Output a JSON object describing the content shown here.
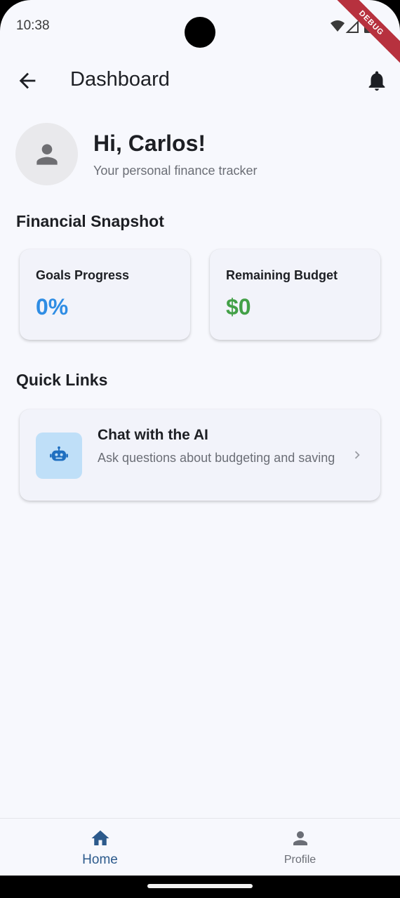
{
  "status_bar": {
    "time": "10:38",
    "debug_label": "DEBUG"
  },
  "app_bar": {
    "title": "Dashboard",
    "back_icon": "arrow-back-icon",
    "action_icon": "bell-icon"
  },
  "greeting": {
    "title": "Hi, Carlos!",
    "subtitle": "Your personal finance tracker",
    "avatar_icon": "person-icon"
  },
  "snapshot": {
    "heading": "Financial Snapshot",
    "cards": [
      {
        "label": "Goals Progress",
        "value": "0%",
        "color": "#2f8de4"
      },
      {
        "label": "Remaining Budget",
        "value": "$0",
        "color": "#43a047"
      }
    ]
  },
  "quick_links": {
    "heading": "Quick Links",
    "items": [
      {
        "title": "Chat with the AI",
        "description": "Ask questions about budgeting and saving",
        "icon": "robot-icon"
      }
    ]
  },
  "bottom_nav": {
    "items": [
      {
        "label": "Home",
        "icon": "home-icon",
        "active": true
      },
      {
        "label": "Profile",
        "icon": "person-icon",
        "active": false
      }
    ],
    "active_color": "#2c5a8c",
    "inactive_color": "#6b6e76"
  }
}
